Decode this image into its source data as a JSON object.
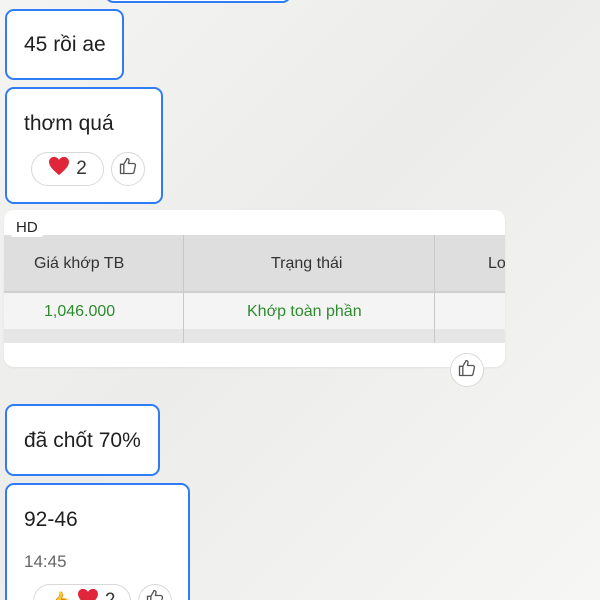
{
  "messages": {
    "msg1_text": "45 rồi ae",
    "msg2_text": "thơm quá",
    "msg2_reaction_count": "2",
    "msg3_text": "đã chốt 70%",
    "msg4_text": "92-46",
    "msg4_time": "14:45",
    "msg4_reaction_count": "2"
  },
  "image_card": {
    "badge": "HD",
    "table_headers": [
      "Giá khớp TB",
      "Trạng thái",
      "Lo"
    ],
    "row1": [
      "1,046.000",
      "Khớp toàn phần"
    ]
  },
  "icons": {
    "heart": "heart-emoji-icon",
    "like": "thumbs-up-icon"
  },
  "colors": {
    "bubble_border": "#2f7cf6",
    "table_green": "#2e8b2e",
    "heart_red": "#e0263a"
  }
}
